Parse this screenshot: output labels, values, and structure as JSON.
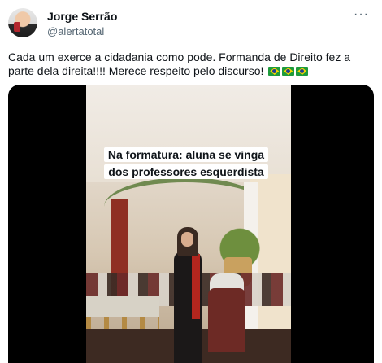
{
  "tweet": {
    "author_name": "Jorge Serrão",
    "author_handle": "@alertatotal",
    "more_icon": "more-horizontal-icon",
    "text": "Cada um exerce a cidadania como pode. Formanda de Direito fez a parte dela direita!!!! Merece respeito pelo discurso!",
    "emoji": [
      "flag-brazil",
      "flag-brazil",
      "flag-brazil"
    ]
  },
  "media": {
    "type": "video",
    "caption_line1": "Na formatura: aluna se vinga",
    "caption_line2": "dos professores esquerdista"
  }
}
